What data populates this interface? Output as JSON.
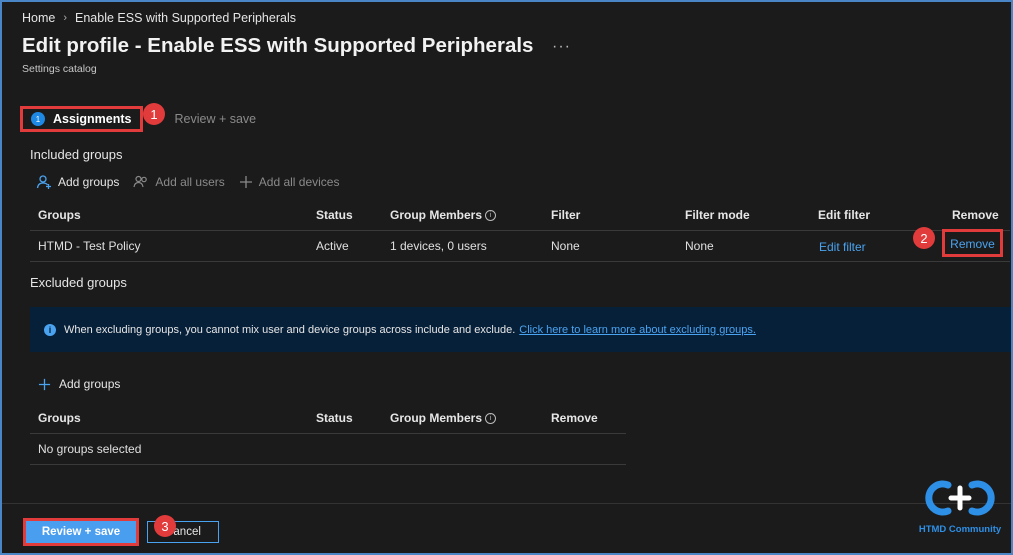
{
  "breadcrumb": {
    "home": "Home",
    "current": "Enable ESS with Supported Peripherals"
  },
  "header": {
    "title": "Edit profile - Enable ESS with Supported Peripherals",
    "subtitle": "Settings catalog",
    "more": "···"
  },
  "stepper": {
    "step1_number": "1",
    "step1_label": "Assignments",
    "step2_label": "Review + save"
  },
  "annotations": {
    "one": "1",
    "two": "2",
    "three": "3"
  },
  "included": {
    "heading": "Included groups",
    "toolbar": {
      "add_groups": "Add groups",
      "add_all_users": "Add all users",
      "add_all_devices": "Add all devices"
    },
    "columns": {
      "groups": "Groups",
      "status": "Status",
      "members": "Group Members",
      "filter": "Filter",
      "filter_mode": "Filter mode",
      "edit_filter": "Edit filter",
      "remove": "Remove"
    },
    "rows": [
      {
        "group": "HTMD - Test Policy",
        "status": "Active",
        "members": "1 devices, 0 users",
        "filter": "None",
        "filter_mode": "None",
        "edit_filter": "Edit filter",
        "remove": "Remove"
      }
    ]
  },
  "excluded": {
    "heading": "Excluded groups",
    "info_text": "When excluding groups, you cannot mix user and device groups across include and exclude.",
    "info_link": "Click here to learn more about excluding groups.",
    "add_groups": "Add groups",
    "columns": {
      "groups": "Groups",
      "status": "Status",
      "members": "Group Members",
      "remove": "Remove"
    },
    "empty": "No groups selected"
  },
  "footer": {
    "review_save": "Review + save",
    "cancel": "Cancel"
  },
  "logo": {
    "caption": "HTMD Community"
  },
  "colors": {
    "accent": "#4a9eef",
    "link": "#4aa3f0",
    "highlight": "#e23b3b",
    "info_bg": "#07203a",
    "background": "#1b1b1b"
  }
}
